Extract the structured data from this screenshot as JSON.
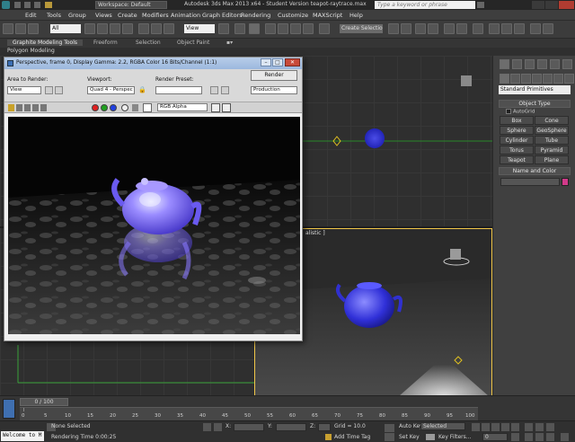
{
  "titlebar": {
    "workspace": "Workspace: Default",
    "title": "Autodesk 3ds Max 2013 x64 - Student Version   teapot-raytrace.max",
    "search_placeholder": "Type a keyword or phrase"
  },
  "menu": [
    "Edit",
    "Tools",
    "Group",
    "Views",
    "Create",
    "Modifiers",
    "Animation",
    "Graph Editors",
    "Rendering",
    "Customize",
    "MAXScript",
    "Help"
  ],
  "toolbar": {
    "selection_filter": "All",
    "ref_coord": "View",
    "named_sel": "Create Selection Se"
  },
  "ribbon": {
    "tabs": [
      "Graphite Modeling Tools",
      "Freeform",
      "Selection",
      "Object Paint"
    ],
    "panel": "Polygon Modeling"
  },
  "render_window": {
    "title": "Perspective, frame 0, Display Gamma: 2.2, RGBA Color 16 Bits/Channel (1:1)",
    "area_label": "Area to Render:",
    "area_value": "View",
    "viewport_label": "Viewport:",
    "viewport_value": "Quad 4 - Perspec",
    "preset_label": "Render Preset:",
    "preset_value": "",
    "render_button": "Render",
    "production_value": "Production",
    "channel_value": "RGB Alpha",
    "win_min": "–",
    "win_max": "□",
    "win_close": "✕"
  },
  "viewport": {
    "br_label": "alistic ]"
  },
  "command_panel": {
    "category": "Standard Primitives",
    "object_type_header": "Object Type",
    "autogrid": "AutoGrid",
    "buttons": [
      "Box",
      "Cone",
      "Sphere",
      "GeoSphere",
      "Cylinder",
      "Tube",
      "Torus",
      "Pyramid",
      "Teapot",
      "Plane"
    ],
    "name_color_header": "Name and Color",
    "object_color": "#d23a8a"
  },
  "timeline": {
    "frame_counter": "0 / 100",
    "ticks": [
      "0",
      "5",
      "10",
      "15",
      "20",
      "25",
      "30",
      "35",
      "40",
      "45",
      "50",
      "55",
      "60",
      "65",
      "70",
      "75",
      "80",
      "85",
      "90",
      "95",
      "100"
    ]
  },
  "status": {
    "listener_text": "Welcome to M",
    "selection_text": "None Selected",
    "rendering_time": "Rendering Time  0:00:25",
    "x_label": "X:",
    "y_label": "Y:",
    "z_label": "Z:",
    "grid": "Grid = 10.0",
    "add_time_tag": "Add Time Tag",
    "auto_key": "Auto Key",
    "auto_key_value": "Selected",
    "set_key": "Set Key",
    "key_filters": "Key Filters...",
    "frame_value": "0"
  }
}
